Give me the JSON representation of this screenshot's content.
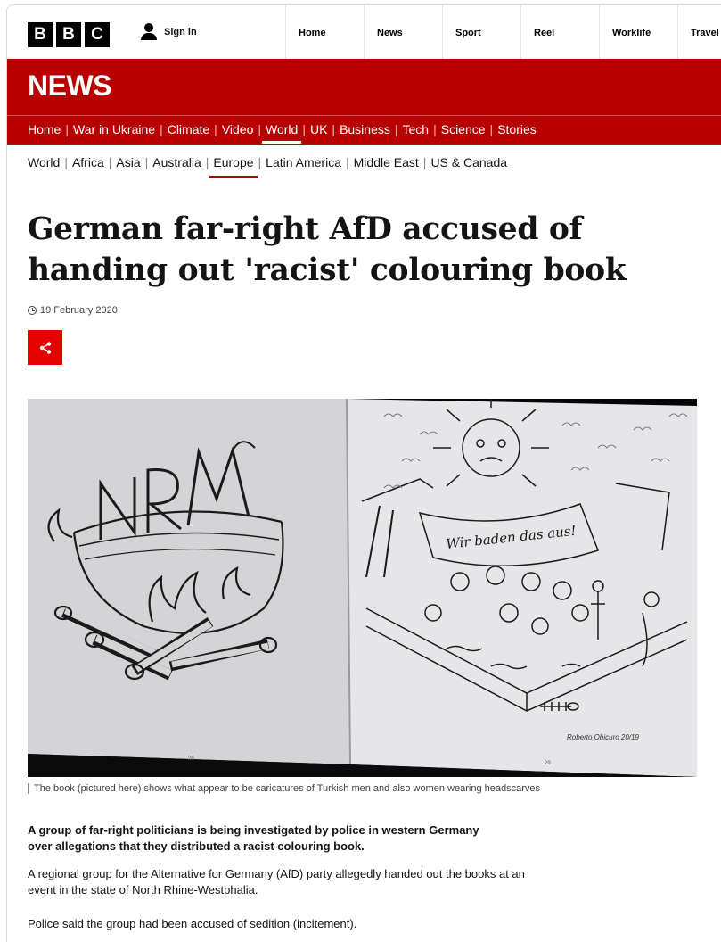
{
  "brand": {
    "logo_letters": [
      "B",
      "B",
      "C"
    ],
    "signin_label": "Sign in"
  },
  "top_nav": [
    "Home",
    "News",
    "Sport",
    "Reel",
    "Worklife",
    "Travel"
  ],
  "news_logo": "NEWS",
  "news_nav": [
    {
      "label": "Home",
      "active": false
    },
    {
      "label": "War in Ukraine",
      "active": false
    },
    {
      "label": "Climate",
      "active": false
    },
    {
      "label": "Video",
      "active": false
    },
    {
      "label": "World",
      "active": true
    },
    {
      "label": "UK",
      "active": false
    },
    {
      "label": "Business",
      "active": false
    },
    {
      "label": "Tech",
      "active": false
    },
    {
      "label": "Science",
      "active": false
    },
    {
      "label": "Stories",
      "active": false
    }
  ],
  "sub_nav": [
    {
      "label": "World",
      "active": false
    },
    {
      "label": "Africa",
      "active": false
    },
    {
      "label": "Asia",
      "active": false
    },
    {
      "label": "Australia",
      "active": false
    },
    {
      "label": "Europe",
      "active": true
    },
    {
      "label": "Latin America",
      "active": false
    },
    {
      "label": "Middle East",
      "active": false
    },
    {
      "label": "US & Canada",
      "active": false
    }
  ],
  "article": {
    "headline": "German far-right AfD accused of handing out 'racist' colouring book",
    "date": "19 February 2020",
    "image_texts": {
      "nrw": "NRW",
      "banner": "Wir baden das aus!",
      "signature": "Roberto Obicuro 20/19",
      "page_left": "28",
      "page_right": "29"
    },
    "caption": "The book (pictured here) shows what appear to be caricatures of Turkish men and also women wearing headscarves",
    "lead": "A group of far-right politicians is being investigated by police in western Germany over allegations that they distributed a racist colouring book.",
    "paragraphs": [
      "A regional group for the Alternative for Germany (AfD) party allegedly handed out the books at an event in the state of North Rhine-Westphalia.",
      "Police said the group had been accused of sedition (incitement)."
    ]
  },
  "colors": {
    "news_red": "#b80000",
    "share_red": "#e60000"
  },
  "icons": {
    "user": "user-icon",
    "clock": "clock-icon",
    "share": "share-icon"
  }
}
